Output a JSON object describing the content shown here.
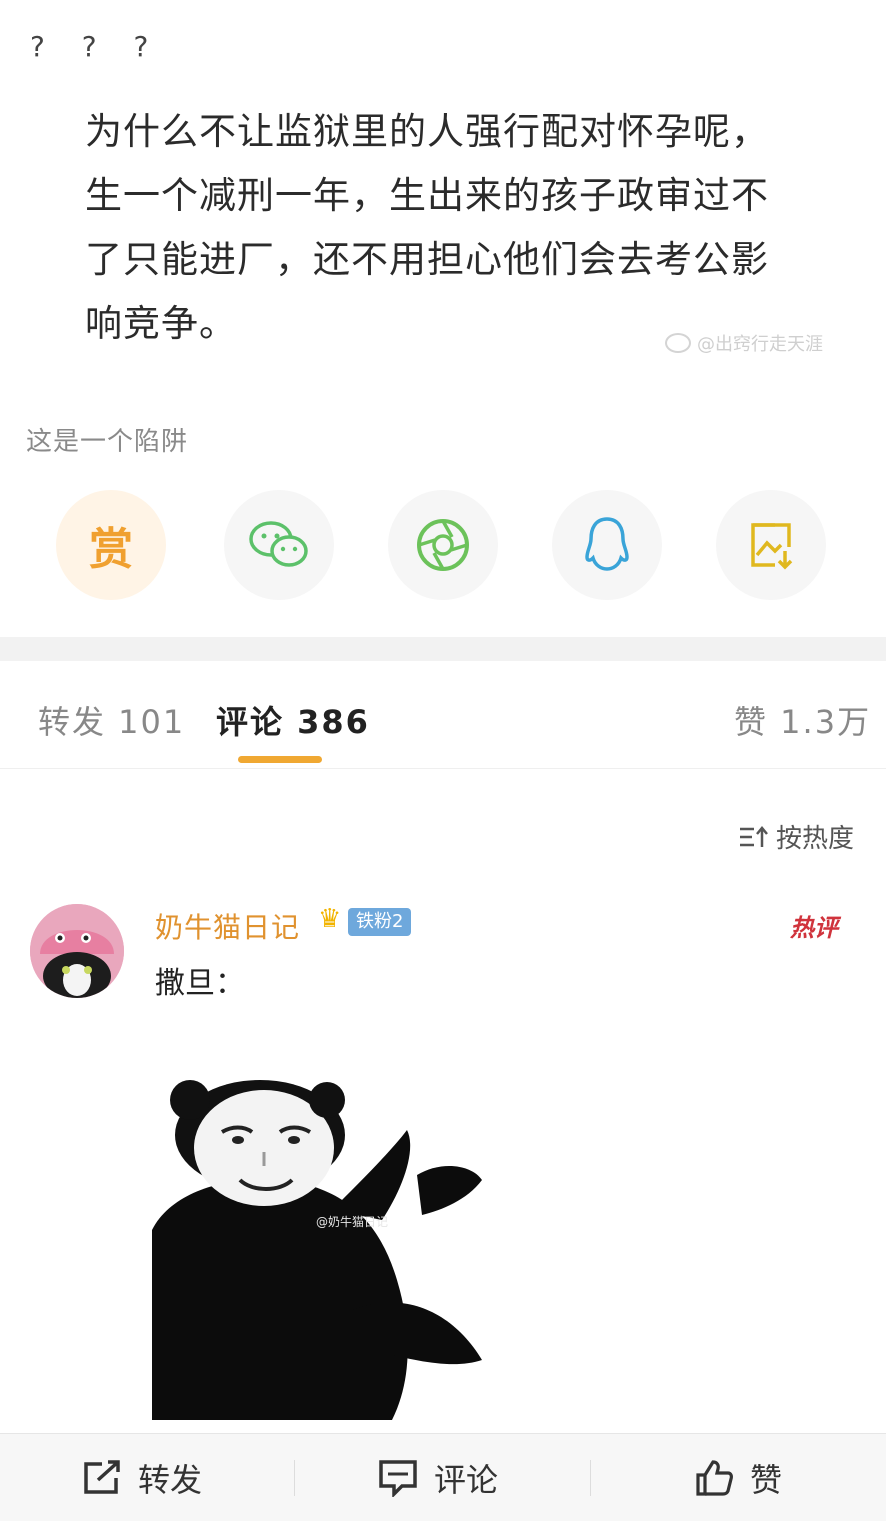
{
  "post": {
    "question_marks": "? ? ?",
    "quote_lines": [
      "为什么不让监狱里的人强行配对怀孕呢，",
      "生一个减刑一年，生出来的孩子政审过不",
      "了只能进厂，还不用担心他们会去考公影",
      "响竞争。"
    ],
    "watermark": "@出窍行走天涯",
    "caption": "这是一个陷阱"
  },
  "share": {
    "reward_label": "赏",
    "icons": [
      "reward-icon",
      "wechat-icon",
      "moments-icon",
      "qq-icon",
      "save-image-icon"
    ],
    "colors": {
      "reward": "#f0a030",
      "wechat": "#5cc16a",
      "moments": "#6cc25a",
      "qq": "#3aa4d8",
      "save": "#e0b81f"
    }
  },
  "tabs": {
    "repost": "转发 101",
    "comments": "评论 386",
    "likes": "赞 1.3万"
  },
  "sort": {
    "label": "按热度"
  },
  "comment": {
    "username": "奶牛猫日记",
    "fan_badge": "铁粉2",
    "hot_badge": "热评",
    "text": "撒旦：",
    "meme_watermark": "@奶牛猫日记"
  },
  "bottom_bar": {
    "repost": "转发",
    "comment": "评论",
    "like": "赞"
  },
  "accent": "#f0a832"
}
